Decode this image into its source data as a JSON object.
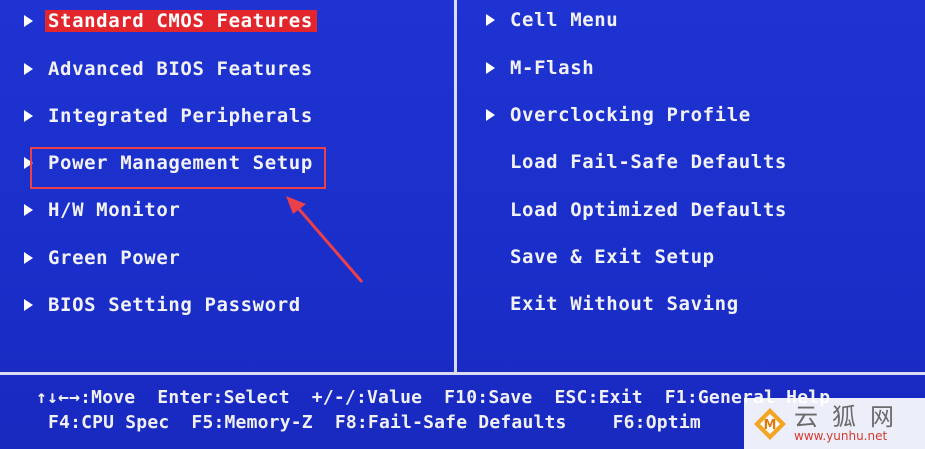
{
  "left_menu": [
    {
      "label": "Standard CMOS Features",
      "arrow": true,
      "selected": true
    },
    {
      "label": "Advanced BIOS Features",
      "arrow": true
    },
    {
      "label": "Integrated Peripherals",
      "arrow": true
    },
    {
      "label": "Power Management Setup",
      "arrow": true
    },
    {
      "label": "H/W Monitor",
      "arrow": true
    },
    {
      "label": "Green Power",
      "arrow": true
    },
    {
      "label": "BIOS Setting Password",
      "arrow": true
    }
  ],
  "right_menu": [
    {
      "label": "Cell Menu",
      "arrow": true
    },
    {
      "label": "M-Flash",
      "arrow": true
    },
    {
      "label": "Overclocking Profile",
      "arrow": true
    },
    {
      "label": "Load Fail-Safe Defaults",
      "arrow": false
    },
    {
      "label": "Load Optimized Defaults",
      "arrow": false
    },
    {
      "label": "Save & Exit Setup",
      "arrow": false
    },
    {
      "label": "Exit Without Saving",
      "arrow": false
    }
  ],
  "footer": {
    "line1": [
      "↑↓←→:Move",
      "Enter:Select",
      "+/-/:Value",
      "F10:Save",
      "ESC:Exit",
      "F1:General Help"
    ],
    "line2": [
      "F4:CPU Spec",
      "F5:Memory-Z",
      "F8:Fail-Safe Defaults",
      "F6:Optim"
    ]
  },
  "watermark": {
    "title": "云狐网",
    "url": "www.yunhu.net"
  },
  "colors": {
    "background": "#1f33d2",
    "selected": "#e2262b",
    "annotation": "#e9404a",
    "text": "#f2f2f6"
  },
  "icons": [
    "menu-arrow-icon",
    "annotation-arrow-icon",
    "yunhu-logo-icon"
  ]
}
